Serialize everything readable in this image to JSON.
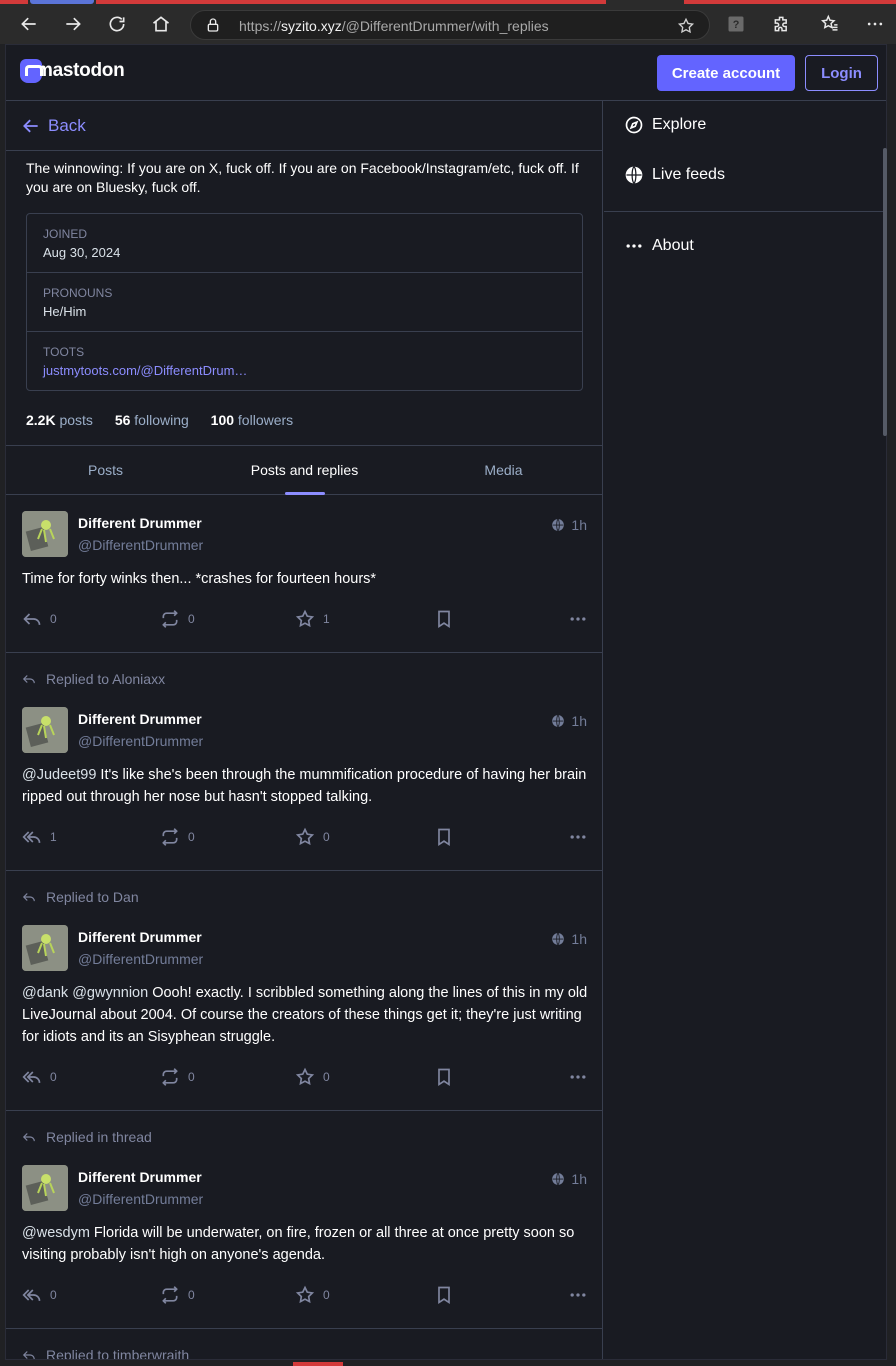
{
  "browser": {
    "url_prefix": "https://",
    "url_domain": "syzito.xyz",
    "url_path": "/@DifferentDrummer/with_replies"
  },
  "header": {
    "logo_text": "mastodon",
    "create_account": "Create account",
    "login": "Login"
  },
  "back_label": "Back",
  "profile": {
    "bio": "The winnowing: If you are on X, fuck off. If you are on Facebook/Instagram/etc, fuck off. If you are on Bluesky, fuck off.",
    "fields": [
      {
        "label": "JOINED",
        "value": "Aug 30, 2024"
      },
      {
        "label": "PRONOUNS",
        "value": "He/Him"
      },
      {
        "label": "TOOTS",
        "value": "justmytoots.com/@DifferentDrum…"
      }
    ],
    "counts": {
      "posts_num": "2.2K",
      "posts_label": "posts",
      "following_num": "56",
      "following_label": "following",
      "followers_num": "100",
      "followers_label": "followers"
    }
  },
  "tabs": [
    {
      "label": "Posts"
    },
    {
      "label": "Posts and replies"
    },
    {
      "label": "Media"
    }
  ],
  "posts": [
    {
      "replied": "",
      "name": "Different Drummer",
      "handle": "@DifferentDrummer",
      "time": "1h",
      "mention": "",
      "text": "Time for forty winks then... *crashes for fourteen hours*",
      "replies": "0",
      "boosts": "0",
      "favs": "1"
    },
    {
      "replied": "Replied to Aloniaxx",
      "name": "Different Drummer",
      "handle": "@DifferentDrummer",
      "time": "1h",
      "mention": "@Judeet99",
      "text": " It's like she's been through the mummification procedure of having her brain ripped out through her nose but hasn't stopped talking.",
      "replies": "1",
      "boosts": "0",
      "favs": "0"
    },
    {
      "replied": "Replied to Dan",
      "name": "Different Drummer",
      "handle": "@DifferentDrummer",
      "time": "1h",
      "mention": "@dank @gwynnion",
      "text": " Oooh!  exactly.  I scribbled something along the lines of this in my old LiveJournal about 2004.  Of course the creators of these things get it; they're just writing for idiots and its an Sisyphean struggle.",
      "replies": "0",
      "boosts": "0",
      "favs": "0"
    },
    {
      "replied": "Replied in thread",
      "name": "Different Drummer",
      "handle": "@DifferentDrummer",
      "time": "1h",
      "mention": "@wesdym",
      "text": " Florida will be underwater, on fire, frozen or all three at once pretty soon so visiting probably isn't high on anyone's agenda.",
      "replies": "0",
      "boosts": "0",
      "favs": "0"
    },
    {
      "replied": "Replied to timberwraith"
    }
  ],
  "nav": {
    "explore": "Explore",
    "live_feeds": "Live feeds",
    "about": "About"
  },
  "colors": {
    "accent": "#8c8dff",
    "brand": "#6364ff",
    "background": "#191b22",
    "border": "#393f4f"
  }
}
